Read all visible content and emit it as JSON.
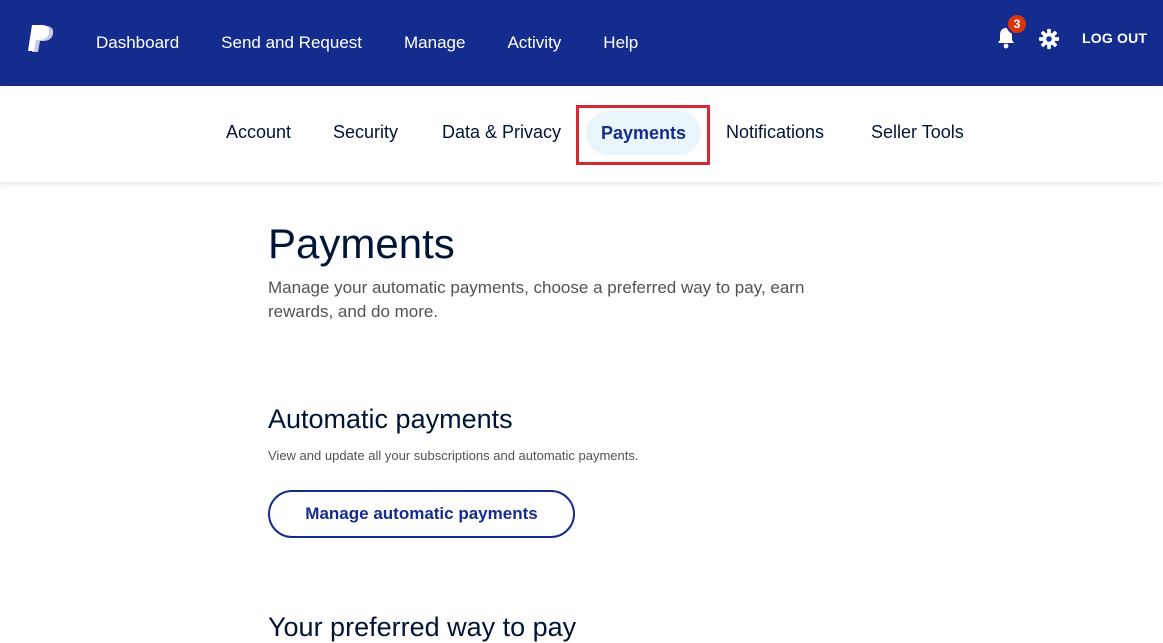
{
  "header": {
    "nav": [
      "Dashboard",
      "Send and Request",
      "Manage",
      "Activity",
      "Help"
    ],
    "notification_count": "3",
    "logout_label": "LOG OUT"
  },
  "subnav": {
    "tabs": [
      "Account",
      "Security",
      "Data & Privacy",
      "Payments",
      "Notifications",
      "Seller Tools"
    ],
    "active": "Payments"
  },
  "page": {
    "title": "Payments",
    "description": "Manage your automatic payments, choose a preferred way to pay, earn rewards, and do more."
  },
  "automatic_payments": {
    "title": "Automatic payments",
    "description": "View and update all your subscriptions and automatic payments.",
    "button_label": "Manage automatic payments"
  },
  "preferred": {
    "title": "Your preferred way to pay"
  },
  "colors": {
    "brand_navy": "#142c8e",
    "badge_red": "#d9360b",
    "highlight_red": "#d42a35",
    "active_tab_bg": "#eaf4fb"
  }
}
